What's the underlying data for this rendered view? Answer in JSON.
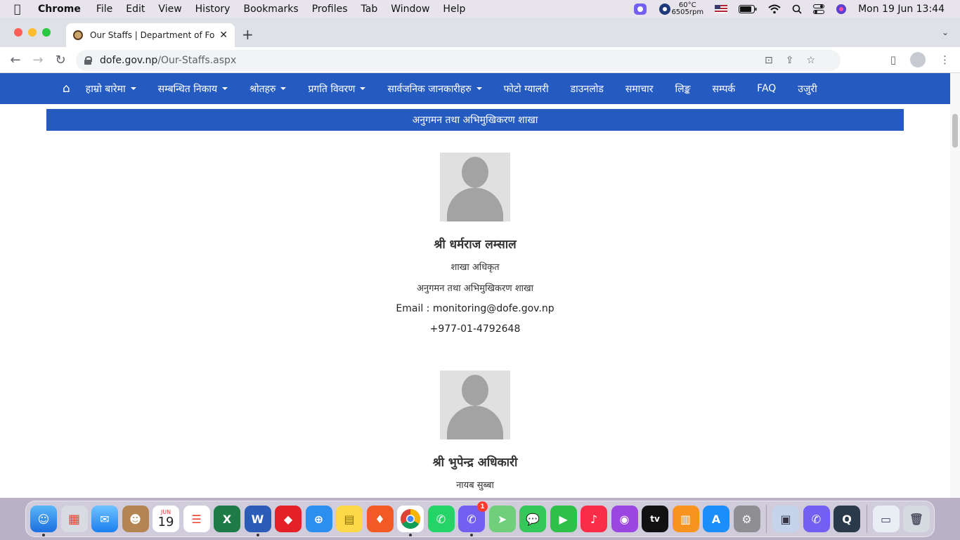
{
  "menubar": {
    "app": "Chrome",
    "items": [
      "File",
      "Edit",
      "View",
      "History",
      "Bookmarks",
      "Profiles",
      "Tab",
      "Window",
      "Help"
    ],
    "temp": "60°C",
    "rpm": "6505rpm",
    "clock": "Mon 19 Jun  13:44"
  },
  "browser": {
    "tab_title": "Our Staffs | Department of Fore",
    "url_domain": "dofe.gov.np",
    "url_path": "/Our-Staffs.aspx"
  },
  "site": {
    "nav": [
      {
        "label": "हाम्रो बारेमा",
        "dropdown": true
      },
      {
        "label": "सम्बन्धित निकाय",
        "dropdown": true
      },
      {
        "label": "श्रोतहरु",
        "dropdown": true
      },
      {
        "label": "प्रगति विवरण",
        "dropdown": true
      },
      {
        "label": "सार्वजनिक जानकारीहरु",
        "dropdown": true
      },
      {
        "label": "फोटो ग्यालरी",
        "dropdown": false
      },
      {
        "label": "डाउनलोड",
        "dropdown": false
      },
      {
        "label": "समाचार",
        "dropdown": false
      },
      {
        "label": "लिङ्क",
        "dropdown": false
      },
      {
        "label": "सम्पर्क",
        "dropdown": false
      },
      {
        "label": "FAQ",
        "dropdown": false
      },
      {
        "label": "उजुरी",
        "dropdown": false
      }
    ],
    "section_title": "अनुगमन तथा अभिमुखिकरण शाखा",
    "staff": [
      {
        "name": "श्री धर्मराज लम्साल",
        "designation": "शाखा अधिकृत",
        "section": "अनुगमन तथा अभिमुखिकरण शाखा",
        "email": "Email : monitoring@dofe.gov.np",
        "phone": "+977-01-4792648"
      },
      {
        "name": "श्री भुपेन्द्र अधिकारी",
        "designation": "नायब सुब्बा"
      }
    ]
  },
  "dock": {
    "calendar_month": "JUN",
    "calendar_day": "19",
    "viber_badge": "1"
  },
  "colors": {
    "site_blue": "#255bc1"
  }
}
